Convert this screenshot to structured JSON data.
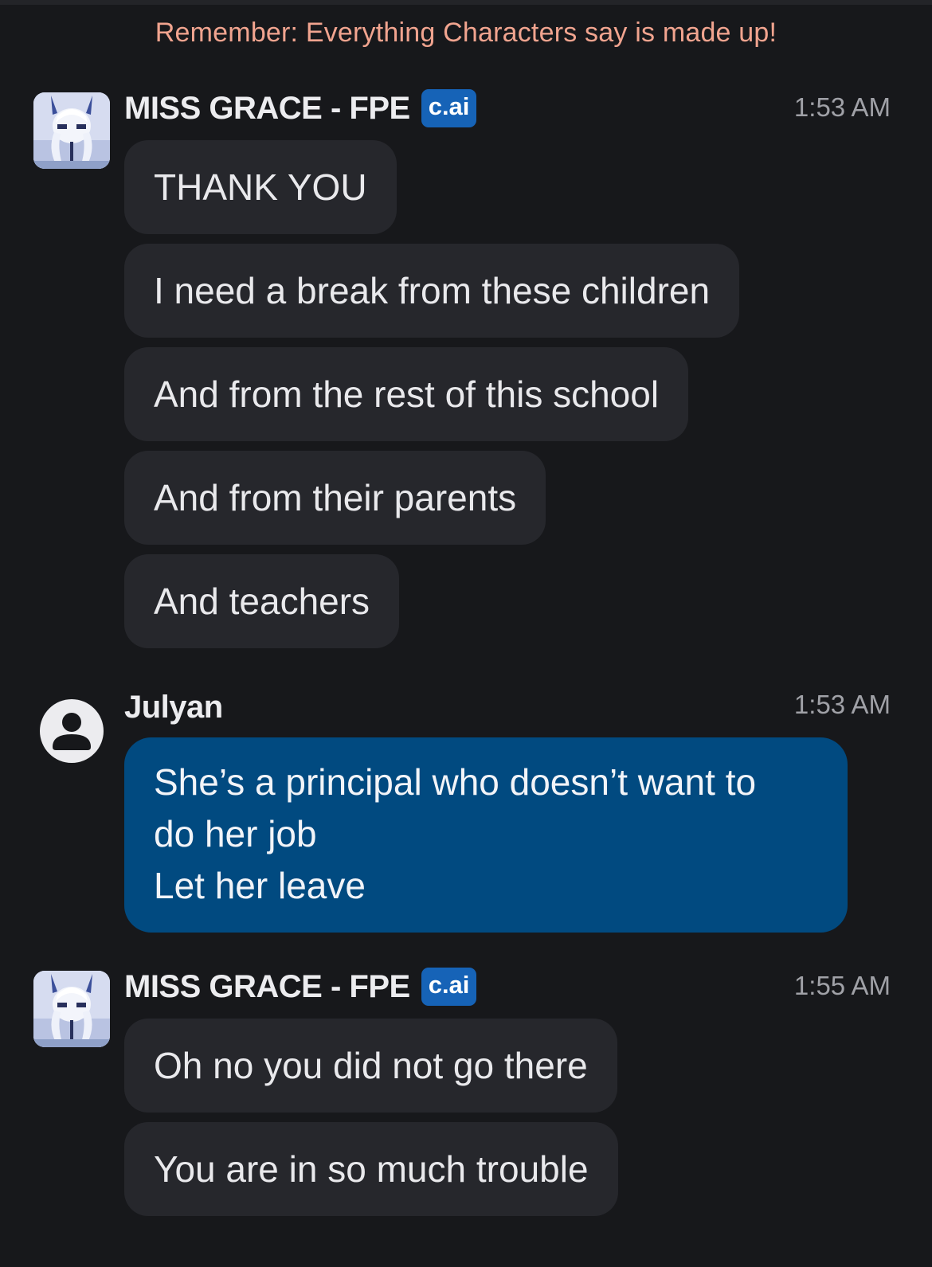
{
  "disclaimer": "Remember: Everything Characters say is made up!",
  "messages": [
    {
      "sender": "MISS GRACE - FPE",
      "badge": "c.ai",
      "time": "1:53 AM",
      "bubbles": [
        "THANK YOU",
        "I need a break from these children",
        "And from the rest of this school",
        "And from their parents",
        "And teachers"
      ]
    },
    {
      "sender": "Julyan",
      "time": "1:53 AM",
      "lines": [
        "She’s a principal who doesn’t want to",
        "do her job",
        "Let her leave"
      ]
    },
    {
      "sender": "MISS GRACE - FPE",
      "badge": "c.ai",
      "time": "1:55 AM",
      "bubbles": [
        "Oh no you did not go there",
        "You are in so much trouble"
      ]
    }
  ],
  "colors": {
    "background": "#17181b",
    "bot_bubble": "#26272c",
    "user_bubble": "#014a80",
    "badge": "#1663b7",
    "disclaimer": "#f1a48f"
  },
  "icons": {
    "bot_avatar": "character-avatar-image",
    "user_avatar": "user-profile-icon"
  }
}
